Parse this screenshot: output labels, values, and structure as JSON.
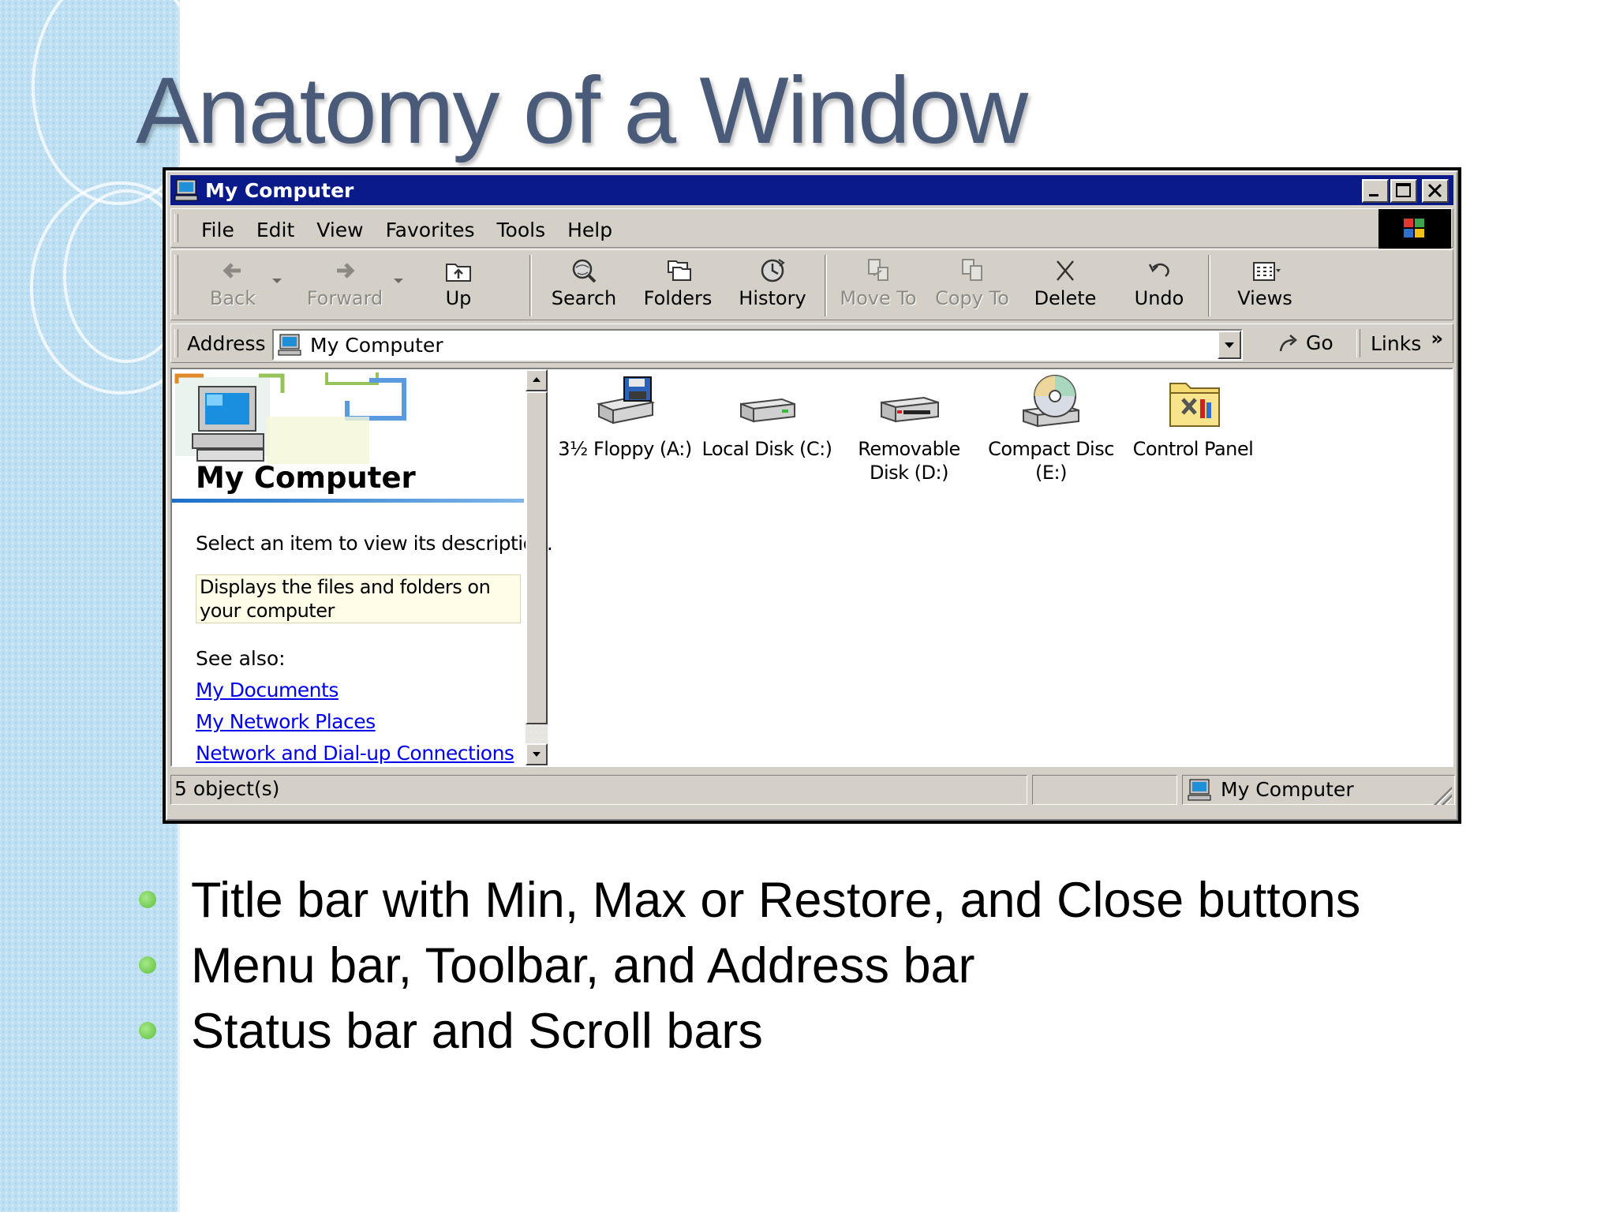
{
  "slide": {
    "title": "Anatomy of a Window",
    "bullets": [
      "Title bar with Min, Max or Restore, and Close buttons",
      "Menu bar, Toolbar, and Address bar",
      "Status bar and Scroll bars"
    ],
    "accent_colors": {
      "title": "#4a5b7a",
      "bullet": "#5dbf3b",
      "band": "#bfe0f2"
    }
  },
  "window": {
    "title": "My Computer",
    "titlebar_color": "#0a1a88",
    "controls": [
      "minimize-icon",
      "maximize-icon",
      "close-icon"
    ],
    "menu": [
      "File",
      "Edit",
      "View",
      "Favorites",
      "Tools",
      "Help"
    ],
    "toolbar": {
      "back": "Back",
      "forward": "Forward",
      "up": "Up",
      "search": "Search",
      "folders": "Folders",
      "history": "History",
      "move_to": "Move To",
      "copy_to": "Copy To",
      "delete": "Delete",
      "undo": "Undo",
      "views": "Views"
    },
    "address": {
      "label": "Address",
      "value": "My Computer",
      "go": "Go",
      "links": "Links",
      "links_more": "»"
    },
    "left_pane": {
      "title": "My Computer",
      "hint": "Select an item to view its description.",
      "description": "Displays the files and folders on your computer",
      "see_also": "See also:",
      "links": [
        "My Documents",
        "My Network Places",
        "Network and Dial-up Connections"
      ]
    },
    "items": [
      {
        "label": "3½ Floppy (A:)",
        "icon": "floppy-drive-icon"
      },
      {
        "label": "Local Disk (C:)",
        "icon": "hard-disk-icon"
      },
      {
        "label": "Removable Disk (D:)",
        "icon": "removable-disk-icon"
      },
      {
        "label": "Compact Disc (E:)",
        "icon": "cd-drive-icon"
      },
      {
        "label": "Control Panel",
        "icon": "control-panel-folder-icon"
      }
    ],
    "status": {
      "objects": "5 object(s)",
      "location": "My Computer"
    }
  }
}
